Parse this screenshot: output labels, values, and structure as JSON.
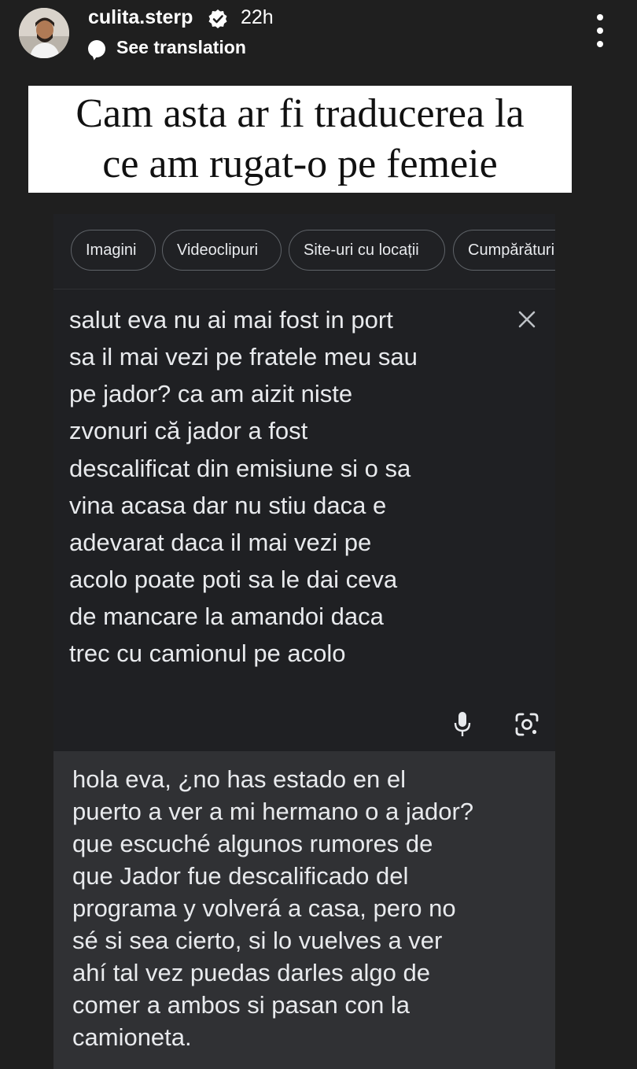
{
  "header": {
    "username": "culita.sterp",
    "time": "22h",
    "see_translation": "See translation"
  },
  "caption": {
    "line1": "Cam asta ar fi traducerea la",
    "line2": "ce am rugat-o pe femeie"
  },
  "chips": [
    "Imagini",
    "Videoclipuri",
    "Site-uri cu locații",
    "Cumpărături"
  ],
  "source_lines": [
    "salut eva nu ai mai fost in port",
    "sa il mai vezi pe fratele meu sau",
    "pe jador? ca am aizit niste",
    "zvonuri că jador a fost",
    "descalificat din emisiune si o sa",
    "vina acasa dar nu stiu daca e",
    "adevarat daca il mai vezi pe",
    "acolo poate poti sa le dai ceva",
    "de mancare la amandoi daca",
    "trec cu camionul pe acolo"
  ],
  "translation_lines": [
    "hola eva, ¿no has estado en el",
    "puerto a ver a mi hermano o a jador?",
    "que escuché algunos rumores de",
    "que Jador fue descalificado del",
    "programa y volverá a casa, pero no",
    "sé si sea cierto, si lo vuelves a ver",
    "ahí tal vez puedas darles algo de",
    "comer a ambos si pasan con la",
    "camioneta."
  ],
  "colors": {
    "background": "#1f1f1f",
    "card": "#202124",
    "translation_panel": "#303134",
    "text": "#e8eaed",
    "verified": "#ffffff"
  },
  "icons": [
    "verified-badge-icon",
    "translate-bubble-icon",
    "more-options-icon",
    "clear-icon",
    "microphone-icon",
    "camera-lens-icon"
  ]
}
